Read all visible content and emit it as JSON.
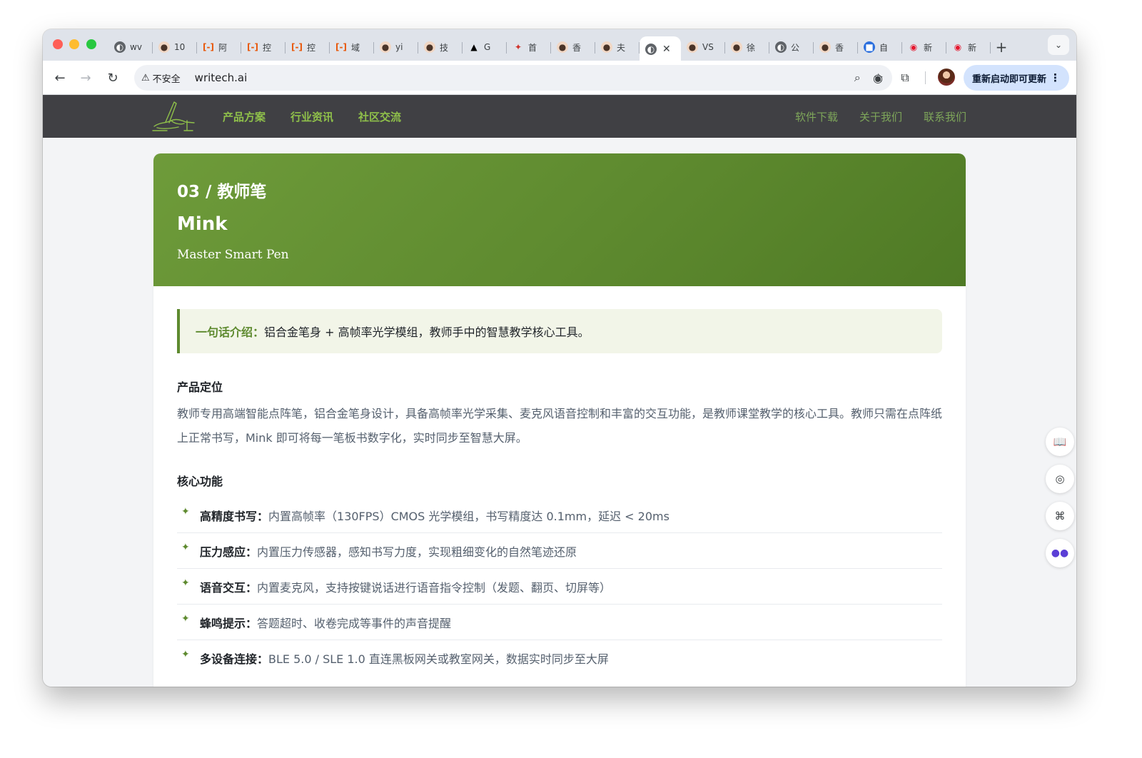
{
  "browser": {
    "tabs": [
      {
        "icon": "globe-icon",
        "label": "wv"
      },
      {
        "icon": "avatar-icon",
        "label": "10"
      },
      {
        "icon": "code-bracket-icon",
        "label": "阿"
      },
      {
        "icon": "code-bracket-icon",
        "label": "控"
      },
      {
        "icon": "code-bracket-icon",
        "label": "控"
      },
      {
        "icon": "code-bracket-icon",
        "label": "域"
      },
      {
        "icon": "avatar-icon",
        "label": "yi"
      },
      {
        "icon": "avatar-icon",
        "label": "技"
      },
      {
        "icon": "triangle-icon",
        "label": "G"
      },
      {
        "icon": "red-logo-icon",
        "label": "首"
      },
      {
        "icon": "avatar-icon",
        "label": "香"
      },
      {
        "icon": "avatar-icon",
        "label": "夫"
      },
      {
        "icon": "globe-icon",
        "label": "",
        "active": true
      },
      {
        "icon": "avatar-icon",
        "label": "VS"
      },
      {
        "icon": "avatar-icon",
        "label": "徐"
      },
      {
        "icon": "globe-icon",
        "label": "公"
      },
      {
        "icon": "avatar-icon",
        "label": "香"
      },
      {
        "icon": "blue-square-icon",
        "label": "自"
      },
      {
        "icon": "weibo-icon",
        "label": "新"
      },
      {
        "icon": "weibo-icon",
        "label": "新"
      }
    ],
    "security_label": "不安全",
    "url": "writech.ai",
    "update_button": "重新启动即可更新"
  },
  "site": {
    "nav_left": [
      "产品方案",
      "行业资讯",
      "社区交流"
    ],
    "nav_right": [
      "软件下载",
      "关于我们",
      "联系我们"
    ]
  },
  "product": {
    "kicker": "03 / 教师笔",
    "name": "Mink",
    "subtitle": "Master Smart Pen",
    "oneline_label": "一句话介绍：",
    "oneline_text": "铝合金笔身 + 高帧率光学模组，教师手中的智慧教学核心工具。",
    "positioning_title": "产品定位",
    "positioning_text": "教师专用高端智能点阵笔，铝合金笔身设计，具备高帧率光学采集、麦克风语音控制和丰富的交互功能，是教师课堂教学的核心工具。教师只需在点阵纸上正常书写，Mink 即可将每一笔板书数字化，实时同步至智慧大屏。",
    "features_title": "核心功能",
    "features": [
      {
        "name": "高精度书写：",
        "desc": "内置高帧率（130FPS）CMOS 光学模组，书写精度达 0.1mm，延迟 < 20ms"
      },
      {
        "name": "压力感应：",
        "desc": "内置压力传感器，感知书写力度，实现粗细变化的自然笔迹还原"
      },
      {
        "name": "语音交互：",
        "desc": "内置麦克风，支持按键说话进行语音指令控制（发题、翻页、切屏等）"
      },
      {
        "name": "蜂鸣提示：",
        "desc": "答题超时、收卷完成等事件的声音提醒"
      },
      {
        "name": "多设备连接：",
        "desc": "BLE 5.0 / SLE 1.0 直连黑板网关或教室网关，数据实时同步至大屏"
      }
    ]
  },
  "colors": {
    "brand_green": "#5e8a2f",
    "nav_bg": "#404044",
    "nav_link": "#8fc04a"
  }
}
